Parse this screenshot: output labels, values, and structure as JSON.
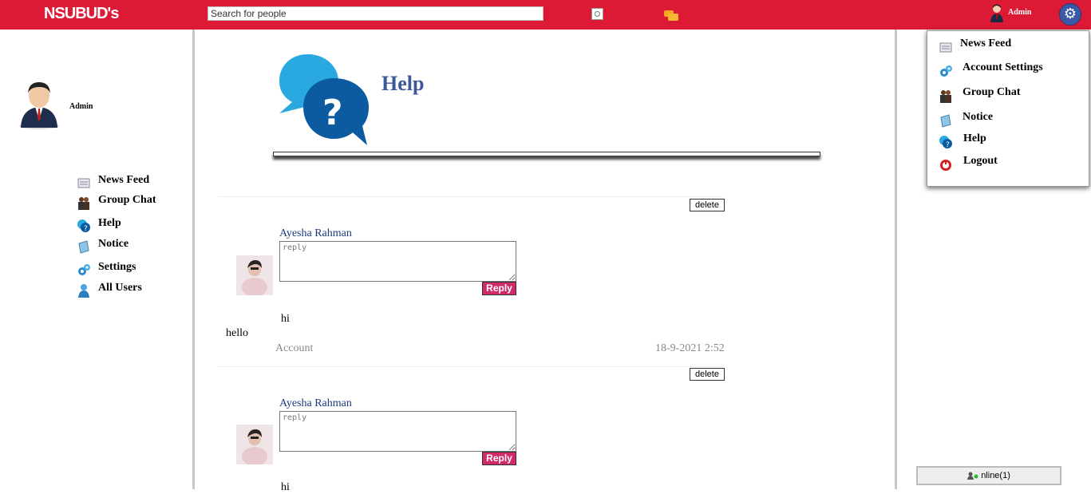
{
  "header": {
    "logo": "NSUBUD's",
    "search_placeholder": "Search for people",
    "user_name": "Admin"
  },
  "profile": {
    "name": "Admin"
  },
  "left_nav": [
    {
      "label": "News Feed",
      "icon": "news-feed-icon"
    },
    {
      "label": "Group Chat",
      "icon": "group-chat-icon"
    },
    {
      "label": "Help",
      "icon": "help-icon"
    },
    {
      "label": "Notice",
      "icon": "notice-icon"
    },
    {
      "label": "Settings",
      "icon": "settings-icon"
    },
    {
      "label": "All Users",
      "icon": "all-users-icon"
    }
  ],
  "page": {
    "title": "Help"
  },
  "posts": [
    {
      "author": "Ayesha Rahman",
      "reply_placeholder": "reply",
      "reply_label": "Reply",
      "delete_label": "delete",
      "text": "hi",
      "comment": "hello",
      "account": "Account",
      "date": "18-9-2021 2:52"
    },
    {
      "author": "Ayesha Rahman",
      "reply_placeholder": "reply",
      "reply_label": "Reply",
      "delete_label": "delete",
      "text": "hi"
    }
  ],
  "dropdown": [
    {
      "label": "News Feed",
      "icon": "news-feed-icon"
    },
    {
      "label": "Account Settings",
      "icon": "settings-icon"
    },
    {
      "label": "Group Chat",
      "icon": "group-chat-icon"
    },
    {
      "label": "Notice",
      "icon": "notice-icon"
    },
    {
      "label": "Help",
      "icon": "help-icon"
    },
    {
      "label": "Logout",
      "icon": "logout-icon"
    }
  ],
  "online": {
    "label": "nline(1)"
  },
  "colors": {
    "header": "#dc1a36",
    "title": "#3b5998",
    "reply_button": "#d12a6b"
  }
}
